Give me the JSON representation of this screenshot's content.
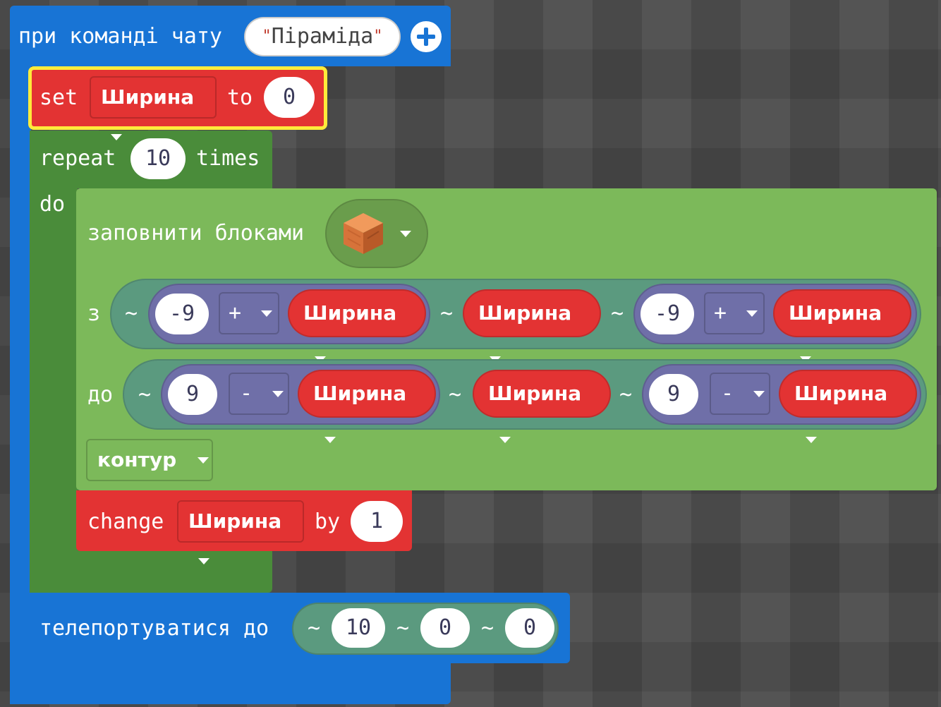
{
  "event": {
    "label": "при команді чату",
    "command": "Піраміда"
  },
  "set_block": {
    "set_label": "set",
    "variable": "Ширина",
    "to_label": "to",
    "value": "0"
  },
  "repeat_block": {
    "repeat_label": "repeat",
    "count": "10",
    "times_label": "times",
    "do_label": "do"
  },
  "fill_block": {
    "label": "заповнити блоками",
    "block_icon": "orange-wood-cube-icon",
    "from_label": "з",
    "to_label": "до",
    "tilde": "~",
    "from": {
      "x": {
        "num": "-9",
        "op": "+",
        "var": "Ширина"
      },
      "y": {
        "var": "Ширина"
      },
      "z": {
        "num": "-9",
        "op": "+",
        "var": "Ширина"
      }
    },
    "to": {
      "x": {
        "num": "9",
        "op": "-",
        "var": "Ширина"
      },
      "y": {
        "var": "Ширина"
      },
      "z": {
        "num": "9",
        "op": "-",
        "var": "Ширина"
      }
    },
    "mode": "контур"
  },
  "change_block": {
    "change_label": "change",
    "variable": "Ширина",
    "by_label": "by",
    "value": "1"
  },
  "teleport_block": {
    "label": "телепортуватися до",
    "x": "10",
    "y": "0",
    "z": "0"
  },
  "colors": {
    "event_blue": "#1874d5",
    "loop_green": "#4a8c3a",
    "builder_green": "#7cb95a",
    "variable_red": "#e33333",
    "position_teal": "#5b9a7f",
    "math_purple": "#6f6fa8",
    "selection_yellow": "#ffeb3b"
  }
}
